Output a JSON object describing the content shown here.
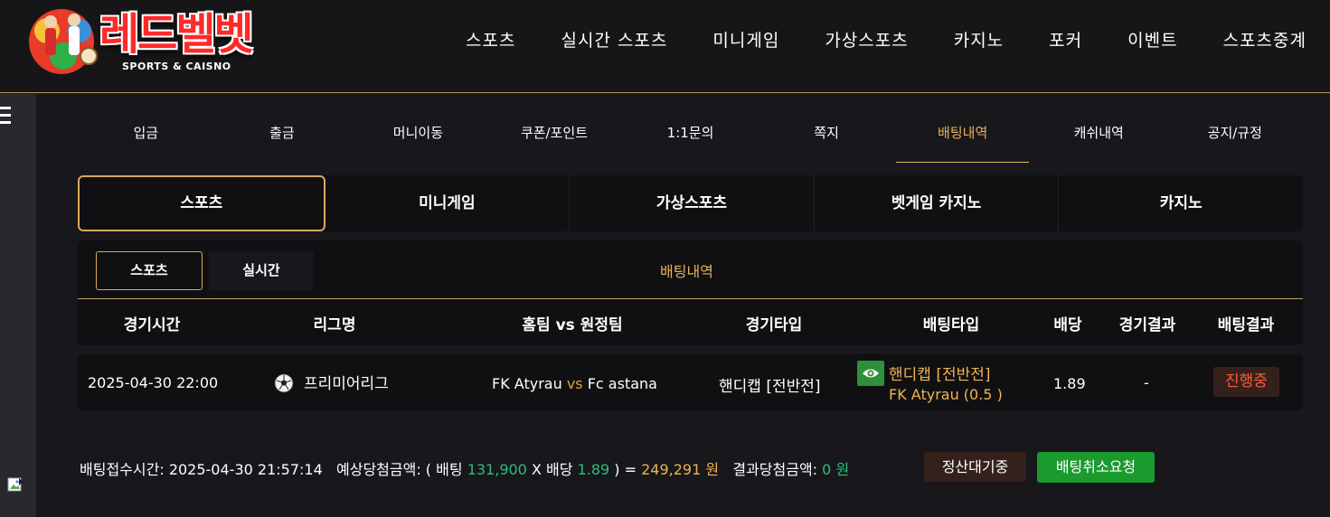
{
  "logo": {
    "title": "레드벨벳",
    "subtitle": "SPORTS & CAISNO"
  },
  "topnav": [
    "스포츠",
    "실시간 스포츠",
    "미니게임",
    "가상스포츠",
    "카지노",
    "포커",
    "이벤트",
    "스포츠중계"
  ],
  "subnav": {
    "items": [
      "입금",
      "출금",
      "머니이동",
      "쿠폰/포인트",
      "1:1문의",
      "쪽지",
      "배팅내역",
      "캐쉬내역",
      "공지/규정"
    ],
    "active": "배팅내역"
  },
  "category_tabs": {
    "items": [
      "스포츠",
      "미니게임",
      "가상스포츠",
      "벳게임 카지노",
      "카지노"
    ],
    "active": "스포츠"
  },
  "panel": {
    "sub_tabs": [
      "스포츠",
      "실시간"
    ],
    "active_sub_tab": "스포츠",
    "title": "배팅내역",
    "headers": [
      "경기시간",
      "리그명",
      "홈팀 vs 원정팀",
      "경기타입",
      "배팅타입",
      "배당",
      "경기결과",
      "배팅결과"
    ]
  },
  "bet_row": {
    "time": "2025-04-30 22:00",
    "league_icon": "soccer-ball-icon",
    "league": "프리미어리그",
    "home": "FK Atyrau",
    "vs": "vs",
    "away": "Fc astana",
    "match_type": "핸디캡 [전반전]",
    "bet_type_icon": "eye-icon",
    "bet_type": "핸디캡 [전반전]",
    "bet_pick": "FK Atyrau (0.5 )",
    "odds": "1.89",
    "result": "-",
    "bet_status": "진행중"
  },
  "summary": {
    "received_label": "배팅접수시간:",
    "received_time": "2025-04-30 21:57:14",
    "expected_label": "예상당첨금액: ( 배팅",
    "stake": "131,900",
    "times_label": "X 배당",
    "odds": "1.89",
    "equals": ") =",
    "expected_amount": "249,291 원",
    "result_label": "결과당첨금액:",
    "result_amount": "0",
    "won": "원",
    "wait_button": "정산대기중",
    "cancel_button": "배팅취소요청"
  },
  "colors": {
    "accent_gold": "#e8b15a",
    "status_red": "#ff5a3a",
    "cancel_green": "#1b9a2e",
    "value_green": "#2bbf7a"
  }
}
